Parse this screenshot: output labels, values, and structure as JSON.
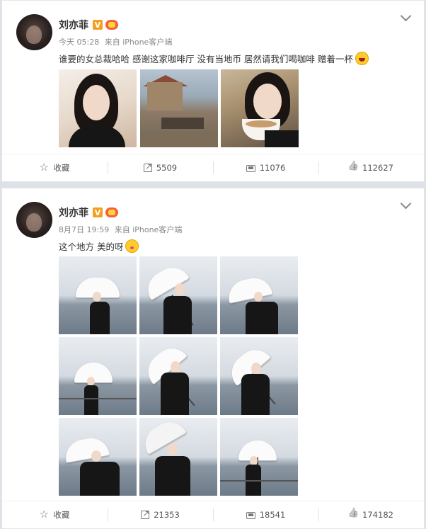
{
  "posts": [
    {
      "author": "刘亦菲",
      "verified_label": "V",
      "time": "今天 05:28",
      "source": "来自 iPhone客户端",
      "text": "谁要的女总裁哈哈 感谢这家咖啡厅 没有当地币 居然请我们喝咖啡 赠着一杯",
      "emoji": "laugh-emoji",
      "photos": [
        "portrait",
        "cafe",
        "coffee"
      ],
      "actions": {
        "favorite": "收藏",
        "repost": "5509",
        "comments": "11076",
        "likes": "112627"
      }
    },
    {
      "author": "刘亦菲",
      "verified_label": "V",
      "time": "8月7日 19:59",
      "source": "来自 iPhone客户端",
      "text": "这个地方 美的呀",
      "emoji": "kiss-emoji",
      "photos": [
        "umbrella-1",
        "umbrella-2",
        "umbrella-3",
        "umbrella-4",
        "umbrella-5",
        "umbrella-6",
        "umbrella-7",
        "umbrella-8",
        "umbrella-9"
      ],
      "actions": {
        "favorite": "收藏",
        "repost": "21353",
        "comments": "18541",
        "likes": "174182"
      }
    }
  ],
  "colors": {
    "page_bg": "#dde1e8",
    "vbadge": "#f3a021",
    "text": "#333333",
    "muted": "#888888"
  }
}
